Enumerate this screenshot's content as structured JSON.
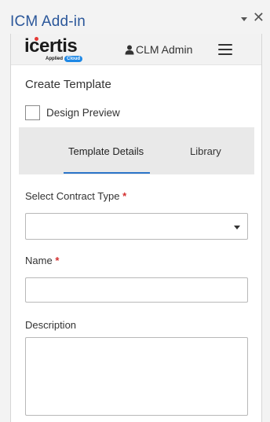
{
  "pane": {
    "title": "ICM Add-in"
  },
  "header": {
    "logo_text": "icertis",
    "logo_tag_left": "Applied",
    "logo_tag_right": "Cloud",
    "user_name": "CLM Admin"
  },
  "form": {
    "title": "Create Template",
    "design_preview_label": "Design Preview",
    "tabs": [
      {
        "label": "Template Details",
        "active": true
      },
      {
        "label": "Library",
        "active": false
      }
    ],
    "contract_type_label": "Select Contract Type",
    "contract_type_value": "",
    "name_label": "Name",
    "name_value": "",
    "description_label": "Description",
    "description_value": "",
    "required_mark": "*"
  },
  "colors": {
    "pane_title": "#2b579a",
    "tab_underline": "#2b75c9",
    "required": "#d32f2f",
    "logo_cloud": "#1e88e5"
  }
}
